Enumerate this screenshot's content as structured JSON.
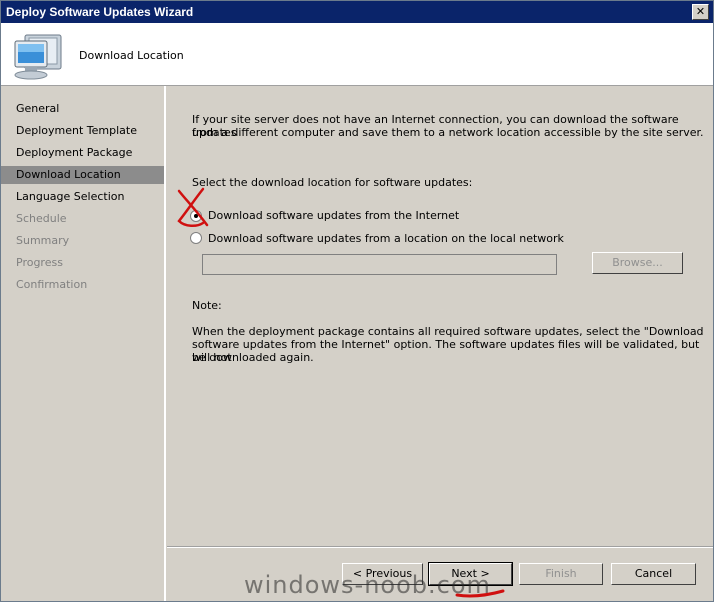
{
  "window": {
    "title": "Deploy Software Updates Wizard",
    "close_glyph": "✕"
  },
  "header": {
    "title": "Download Location",
    "icon": "computer-icon"
  },
  "sidebar": {
    "items": [
      {
        "label": "General",
        "state": "normal"
      },
      {
        "label": "Deployment Template",
        "state": "normal"
      },
      {
        "label": "Deployment Package",
        "state": "normal"
      },
      {
        "label": "Download Location",
        "state": "selected"
      },
      {
        "label": "Language Selection",
        "state": "normal"
      },
      {
        "label": "Schedule",
        "state": "disabled"
      },
      {
        "label": "Summary",
        "state": "disabled"
      },
      {
        "label": "Progress",
        "state": "disabled"
      },
      {
        "label": "Confirmation",
        "state": "disabled"
      }
    ]
  },
  "content": {
    "intro_line1": "If your site server does not have an Internet connection, you can download the software updates",
    "intro_line2": "from a different computer and save them to a network location accessible by the site server.",
    "select_label": "Select the download location for software updates:",
    "option_internet": "Download software updates from the Internet",
    "option_local": "Download software updates from a location on the local network",
    "path_value": "",
    "browse_label": "Browse...",
    "note_label": "Note:",
    "note_line1": "When the deployment package contains all required software updates, select the \"Download",
    "note_line2": "software updates from the Internet\" option. The software updates files will be validated, but will not",
    "note_line3": "be downloaded again."
  },
  "footer": {
    "previous_label": "< Previous",
    "next_label": "Next >",
    "finish_label": "Finish",
    "cancel_label": "Cancel"
  },
  "watermark": "windows-noob.com",
  "colors": {
    "titlebar": "#0a246a",
    "selected": "#8c8c8c",
    "annotation": "#d01010"
  }
}
